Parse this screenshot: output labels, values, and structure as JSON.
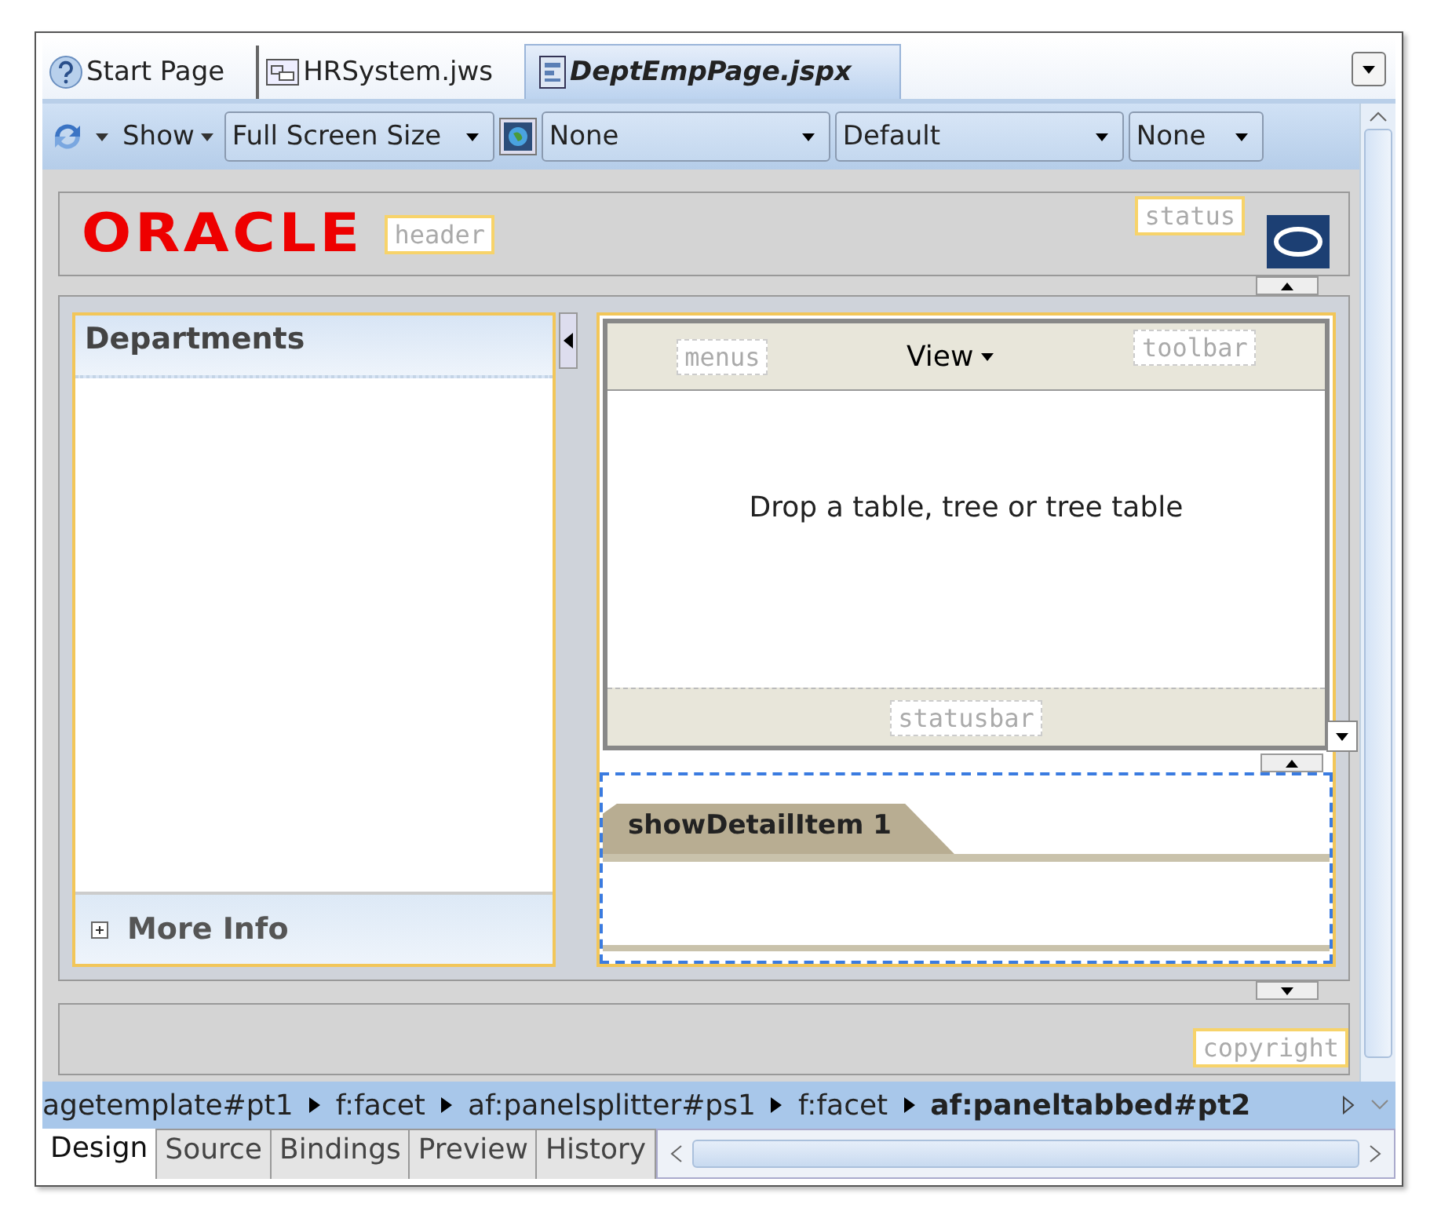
{
  "editor_tabs": [
    {
      "label": "Start Page",
      "kind": "help",
      "selected": false
    },
    {
      "label": "HRSystem.jws",
      "kind": "workspace",
      "selected": false
    },
    {
      "label": "DeptEmpPage.jspx",
      "kind": "page",
      "selected": true
    }
  ],
  "toolbar": {
    "show_label": "Show",
    "dropdowns": [
      "Full Screen Size",
      "None",
      "Default",
      "None"
    ]
  },
  "template": {
    "logo": "ORACLE",
    "header_facet": "header",
    "status_facet": "status",
    "left_panel": {
      "title": "Departments",
      "footer": "More Info",
      "footer_expanded": false
    },
    "center": {
      "menus_facet": "menus",
      "view_menu": "View",
      "toolbar_facet": "toolbar",
      "empty_text": "Drop a table, tree or tree table",
      "statusbar_facet": "statusbar"
    },
    "detail_tabs": [
      {
        "label": "showDetailItem 1",
        "selected": true
      }
    ],
    "copyright_facet": "copyright"
  },
  "breadcrumb": [
    {
      "label": "agetemplate#pt1",
      "selected": false
    },
    {
      "label": "f:facet",
      "selected": false
    },
    {
      "label": "af:panelsplitter#ps1",
      "selected": false
    },
    {
      "label": "f:facet",
      "selected": false
    },
    {
      "label": "af:paneltabbed#pt2",
      "selected": true
    }
  ],
  "bottom_tabs": [
    {
      "label": "Design",
      "selected": true
    },
    {
      "label": "Source",
      "selected": false
    },
    {
      "label": "Bindings",
      "selected": false
    },
    {
      "label": "Preview",
      "selected": false
    },
    {
      "label": "History",
      "selected": false
    }
  ]
}
